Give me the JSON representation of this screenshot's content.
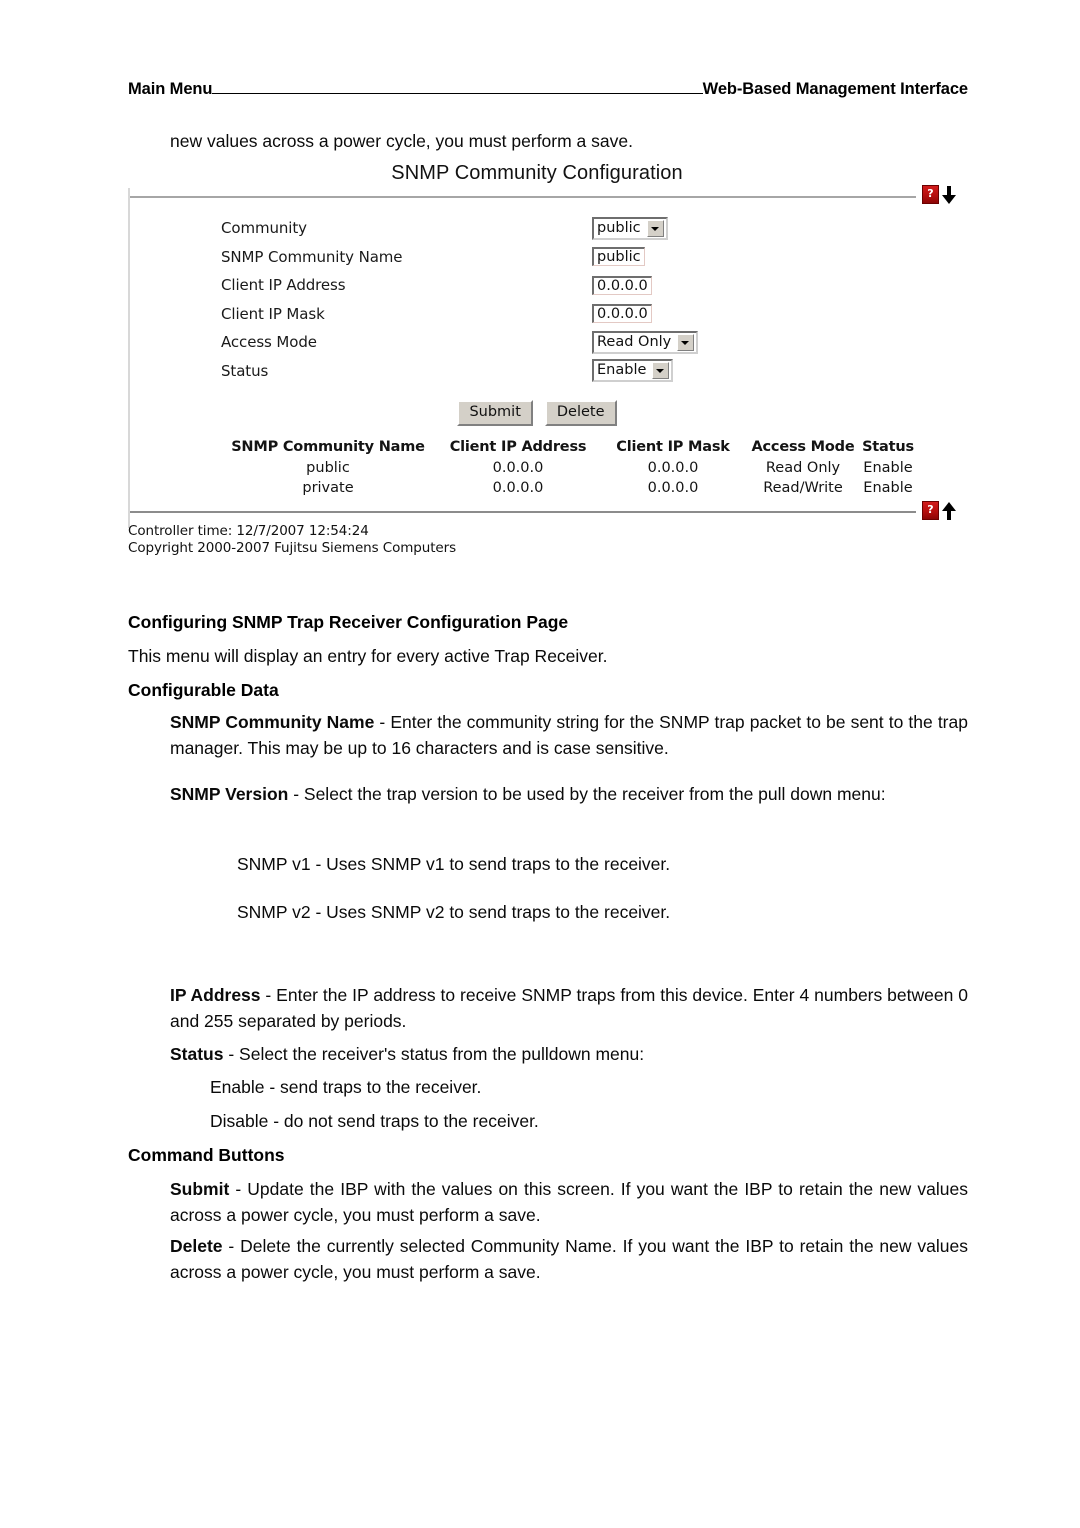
{
  "doc_header": {
    "left": "Main Menu",
    "right": "Web-Based Management Interface"
  },
  "intro_line": "new values across a power cycle, you must perform a save.",
  "panel": {
    "title": "SNMP Community Configuration",
    "help_icon_label": "?",
    "help_icon_color": "#b20d0d",
    "fields": [
      {
        "label": "Community",
        "type": "select",
        "value": "public"
      },
      {
        "label": "SNMP Community Name",
        "type": "text",
        "value": "public"
      },
      {
        "label": "Client IP Address",
        "type": "text",
        "value": "0.0.0.0"
      },
      {
        "label": "Client IP Mask",
        "type": "text",
        "value": "0.0.0.0"
      },
      {
        "label": "Access Mode",
        "type": "select",
        "value": "Read Only"
      },
      {
        "label": "Status",
        "type": "select",
        "value": "Enable"
      }
    ],
    "buttons": {
      "submit": "Submit",
      "delete": "Delete"
    },
    "table": {
      "headers": [
        "SNMP Community Name",
        "Client IP Address",
        "Client IP Mask",
        "Access Mode",
        "Status"
      ],
      "rows": [
        [
          "public",
          "0.0.0.0",
          "0.0.0.0",
          "Read Only",
          "Enable"
        ],
        [
          "private",
          "0.0.0.0",
          "0.0.0.0",
          "Read/Write",
          "Enable"
        ]
      ]
    },
    "footer": {
      "controller_time": "Controller time: 12/7/2007 12:54:24",
      "copyright": "Copyright 2000-2007 Fujitsu Siemens Computers"
    }
  },
  "content": {
    "h_configuring": "Configuring SNMP Trap Receiver Configuration Page",
    "p_menu_display": "This menu will display an entry for every active Trap Receiver.",
    "h_configurable_data": "Configurable Data",
    "snmp_community_name_term": "SNMP Community Name",
    "snmp_community_name_desc": " - Enter the community string for the SNMP trap packet to be sent to the trap manager. This may be up to 16 characters and is case sensitive.",
    "snmp_version_term": "SNMP Version",
    "snmp_version_desc": " - Select the trap version to be used by the receiver from the pull down menu:",
    "snmp_v1_line": "SNMP v1 - Uses SNMP v1 to send traps to the receiver.",
    "snmp_v2_line": "SNMP v2 - Uses SNMP v2 to send traps to the receiver.",
    "ip_address_term": "IP Address",
    "ip_address_desc": " - Enter the IP address to receive SNMP traps from this device. Enter 4 numbers between 0 and 255 separated by periods.",
    "status_term": "Status",
    "status_desc": " - Select the receiver's status from the pulldown menu:",
    "status_enable_line": "Enable - send traps to the receiver.",
    "status_disable_line": "Disable - do not send traps to the receiver.",
    "h_command_buttons": "Command Buttons",
    "submit_term": "Submit",
    "submit_desc": " - Update the IBP with the values on this screen. If you want the IBP to retain the new values across a power cycle, you must perform a save.",
    "delete_term": "Delete",
    "delete_desc": " - Delete the currently selected Community Name. If you want the IBP to retain the new values across a power cycle, you must perform a save."
  }
}
